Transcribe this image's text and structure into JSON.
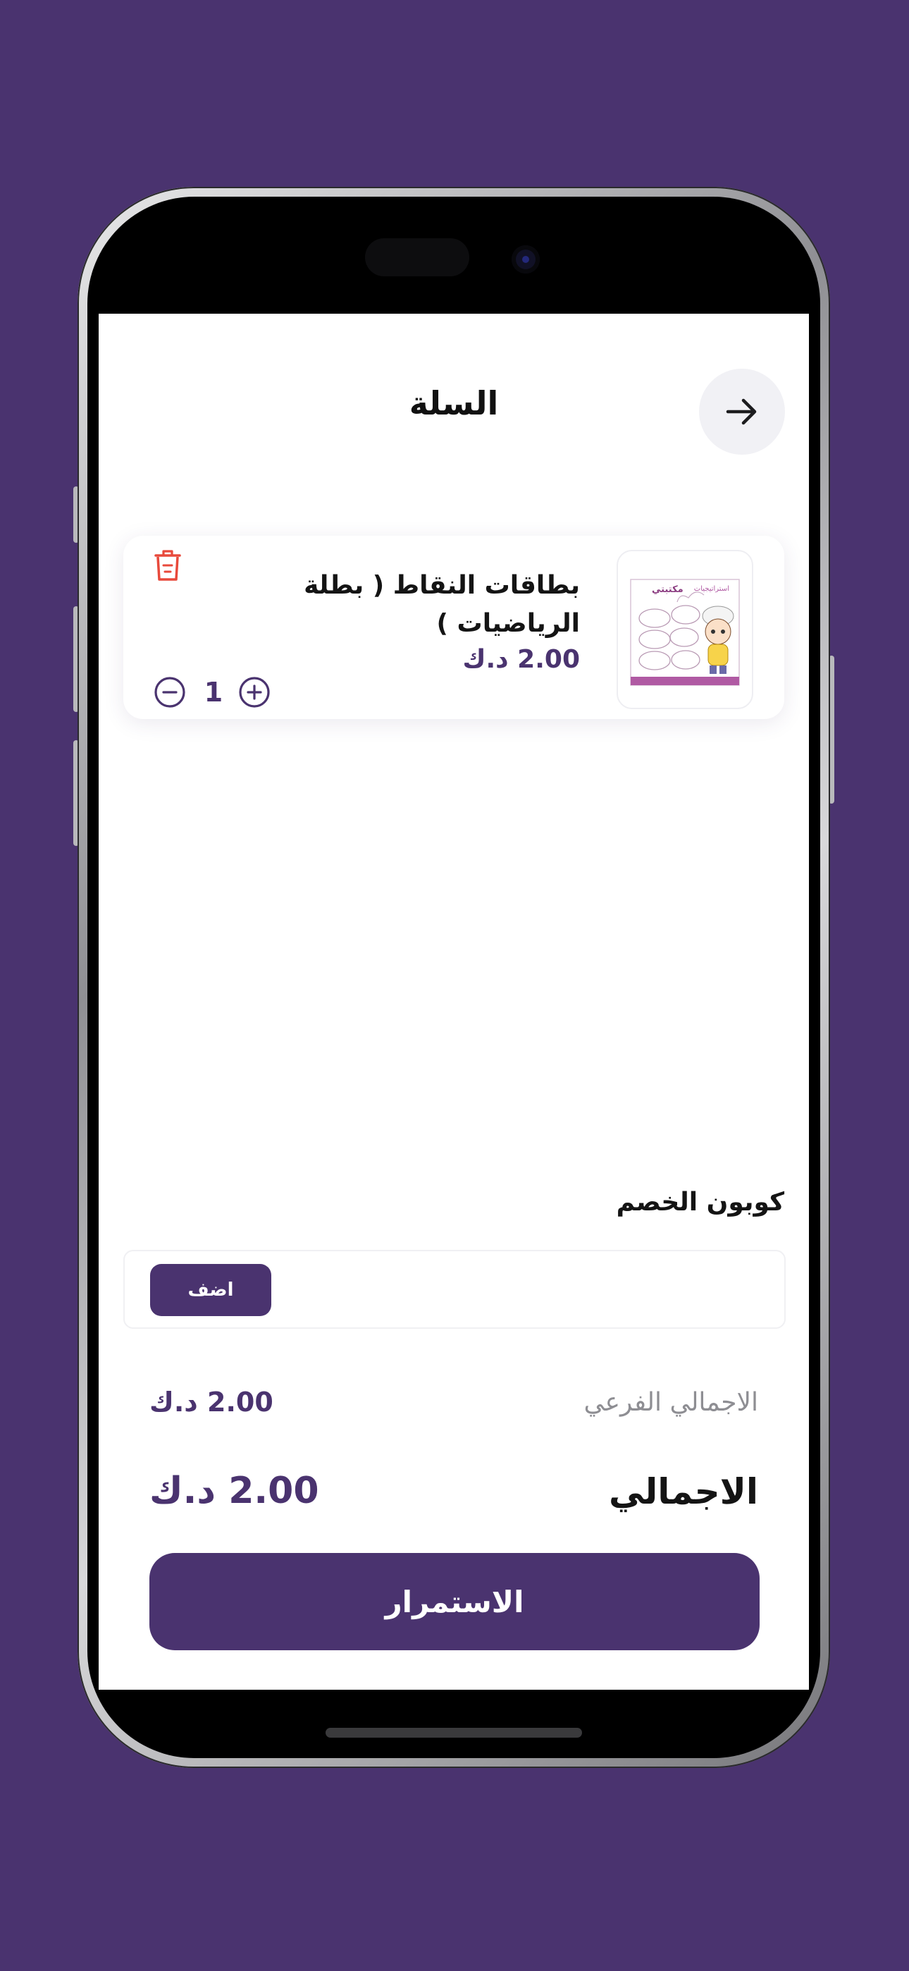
{
  "header": {
    "title": "السلة",
    "back_icon": "arrow-right-icon"
  },
  "cart": {
    "items": [
      {
        "name": "بطاقات النقاط ( بطلة الرياضيات )",
        "price": "2.00 د.ك",
        "quantity": "1",
        "thumbnail": {
          "brand": "مكتبتي",
          "caption": "استراتيجيات"
        }
      }
    ]
  },
  "coupon": {
    "label": "كوبون الخصم",
    "placeholder": "",
    "add_label": "اضف"
  },
  "summary": {
    "subtotal_label": "الاجمالي الفرعي",
    "subtotal_value": "2.00 د.ك",
    "total_label": "الاجمالي",
    "total_value": "2.00 د.ك"
  },
  "actions": {
    "continue_label": "الاستمرار"
  },
  "colors": {
    "brand": "#4a336f",
    "danger": "#e8493b",
    "background": "#4a336f"
  }
}
